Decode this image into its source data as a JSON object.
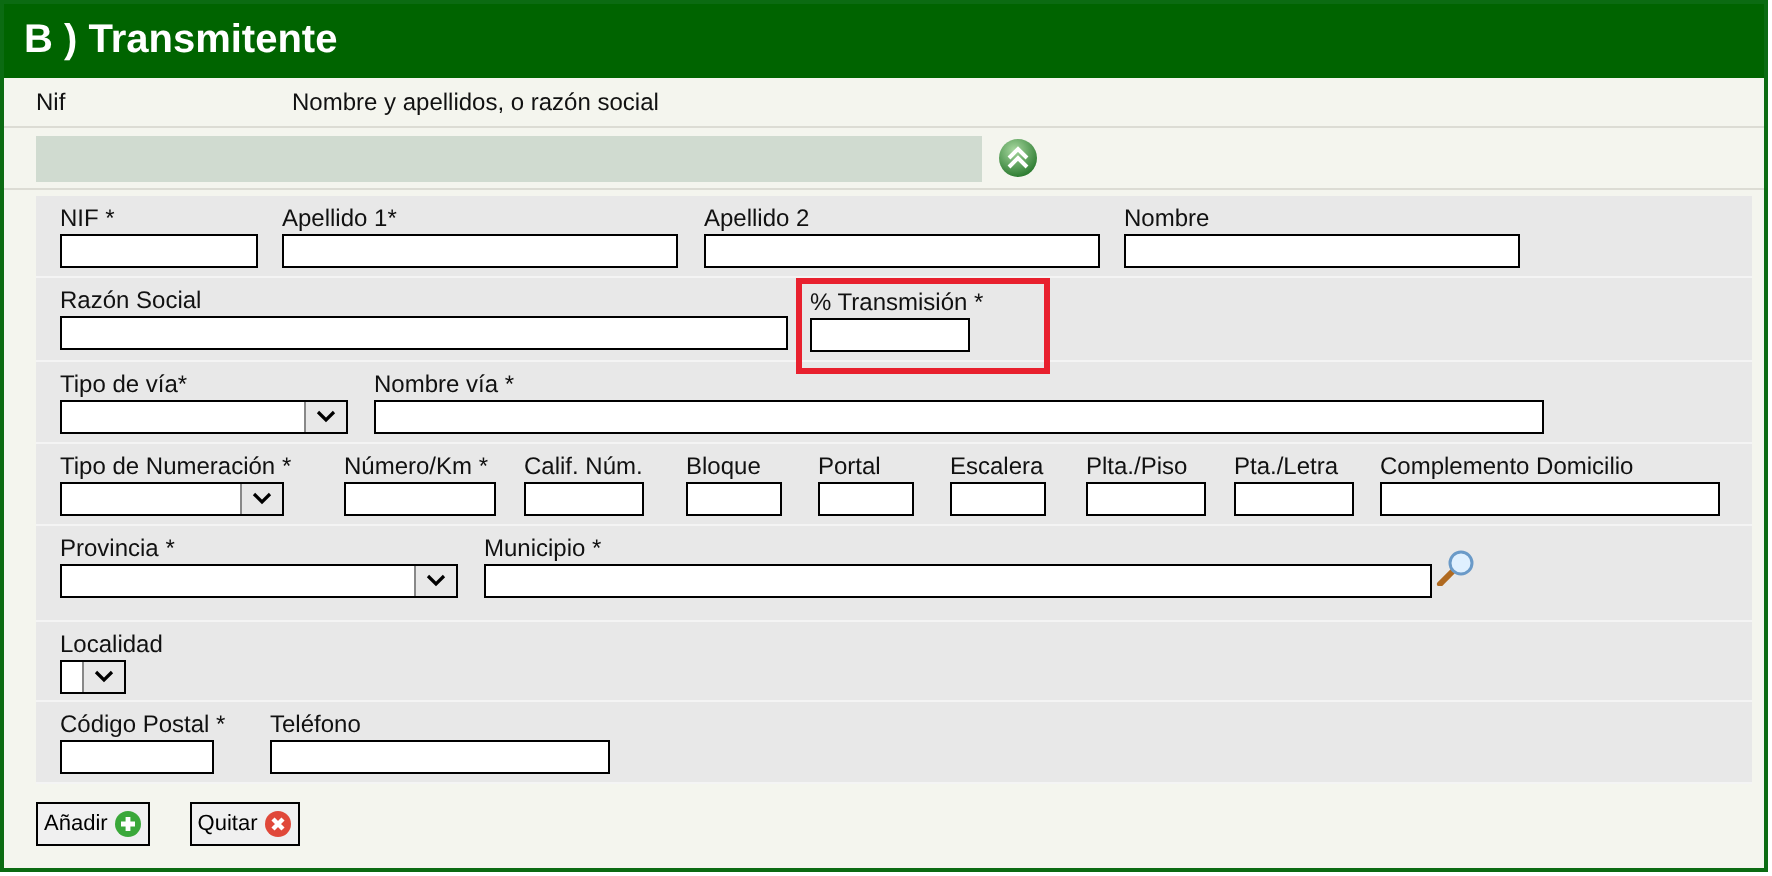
{
  "section": {
    "title": "B ) Transmitente"
  },
  "list_header": {
    "columns": [
      "Nif",
      "Nombre y apellidos, o razón social"
    ]
  },
  "form": {
    "expanded": true,
    "rows": [
      {
        "fields": [
          {
            "label": "NIF *",
            "kind": "text",
            "highlighted": false
          },
          {
            "label": "Apellido 1*",
            "kind": "text",
            "highlighted": false
          },
          {
            "label": "Apellido 2",
            "kind": "text",
            "highlighted": false
          },
          {
            "label": "Nombre",
            "kind": "text",
            "highlighted": false
          }
        ]
      },
      {
        "fields": [
          {
            "label": "Razón Social",
            "kind": "text",
            "highlighted": false
          },
          {
            "label": "% Transmisión *",
            "kind": "text",
            "highlighted": true
          }
        ]
      },
      {
        "fields": [
          {
            "label": "Tipo de vía*",
            "kind": "select",
            "highlighted": false
          },
          {
            "label": "Nombre vía *",
            "kind": "text",
            "highlighted": false
          }
        ]
      },
      {
        "fields": [
          {
            "label": "Tipo de Numeración *",
            "kind": "select",
            "highlighted": false
          },
          {
            "label": "Número/Km *",
            "kind": "text",
            "highlighted": false
          },
          {
            "label": "Calif. Núm.",
            "kind": "text",
            "highlighted": false
          },
          {
            "label": "Bloque",
            "kind": "text",
            "highlighted": false
          },
          {
            "label": "Portal",
            "kind": "text",
            "highlighted": false
          },
          {
            "label": "Escalera",
            "kind": "text",
            "highlighted": false
          },
          {
            "label": "Plta./Piso",
            "kind": "text",
            "highlighted": false
          },
          {
            "label": "Pta./Letra",
            "kind": "text",
            "highlighted": false
          },
          {
            "label": "Complemento Domicilio",
            "kind": "text",
            "highlighted": false
          }
        ]
      },
      {
        "fields": [
          {
            "label": "Provincia *",
            "kind": "select",
            "highlighted": false
          },
          {
            "label": "Municipio *",
            "kind": "lookup",
            "highlighted": false
          }
        ]
      },
      {
        "fields": [
          {
            "label": "Localidad",
            "kind": "select",
            "highlighted": false
          }
        ]
      },
      {
        "fields": [
          {
            "label": "Código Postal *",
            "kind": "text",
            "highlighted": false
          },
          {
            "label": "Teléfono",
            "kind": "text",
            "highlighted": false
          }
        ]
      }
    ]
  },
  "buttons": [
    {
      "label": "Añadir",
      "kind": "add"
    },
    {
      "label": "Quitar",
      "kind": "remove"
    }
  ]
}
